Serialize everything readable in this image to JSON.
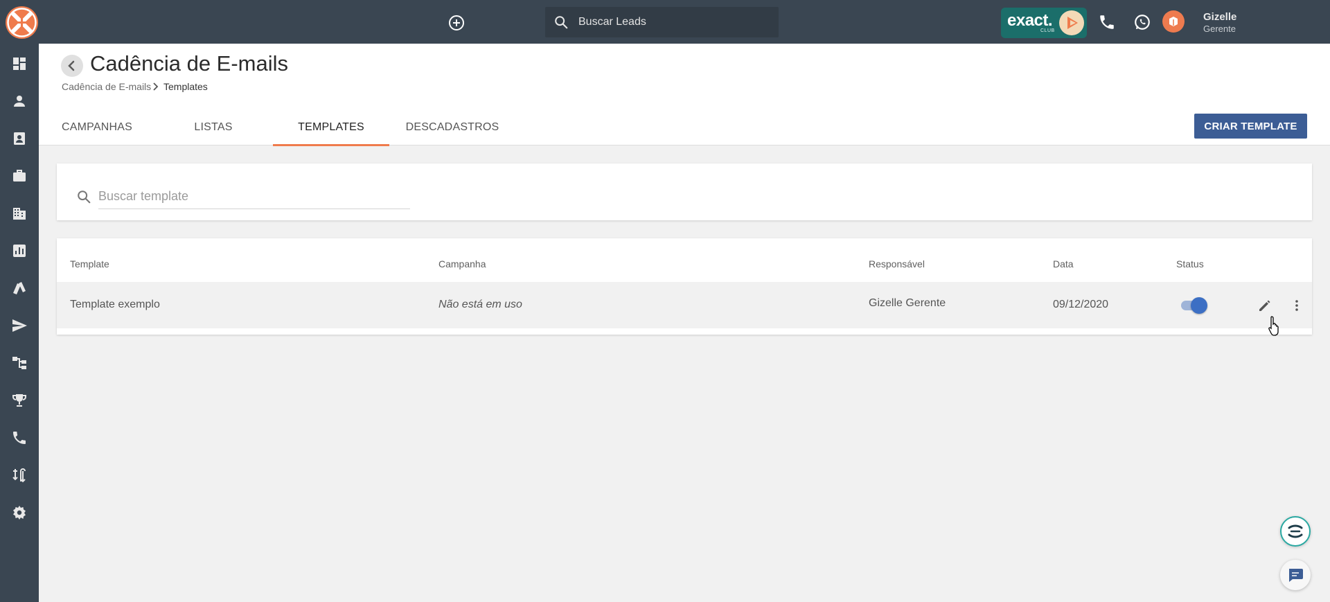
{
  "topbar": {
    "search_placeholder": "Buscar Leads",
    "badge": {
      "brand": "exact.",
      "sub": "CLUB"
    },
    "user": {
      "name": "Gizelle",
      "role": "Gerente"
    }
  },
  "sidebar": {
    "items": [
      "dashboard-icon",
      "person-icon",
      "contact-card-icon",
      "briefcase-icon",
      "building-icon",
      "report-chart-icon",
      "cards-icon",
      "send-icon",
      "hierarchy-icon",
      "trophy-icon",
      "phone-icon",
      "transfer-icon",
      "settings-icon"
    ]
  },
  "header": {
    "title": "Cadência de E-mails",
    "breadcrumb": {
      "parent": "Cadência de E-mails",
      "current": "Templates"
    },
    "tabs": [
      {
        "label": "CAMPANHAS",
        "active": false
      },
      {
        "label": "LISTAS",
        "active": false
      },
      {
        "label": "TEMPLATES",
        "active": true
      },
      {
        "label": "DESCADASTROS",
        "active": false
      }
    ],
    "create_button": "CRIAR TEMPLATE"
  },
  "search": {
    "placeholder": "Buscar template"
  },
  "table": {
    "columns": [
      "Template",
      "Campanha",
      "Responsável",
      "Data",
      "Status"
    ],
    "rows": [
      {
        "template": "Template exemplo",
        "campanha": "Não está em uso",
        "responsavel": "Gizelle Gerente",
        "data": "09/12/2020",
        "status": true
      }
    ]
  },
  "colors": {
    "topbar": "#3a4652",
    "accent_orange": "#ef7b4c",
    "primary_button": "#3c5d95",
    "toggle_on": "#3c6fc4",
    "badge_teal": "#1b6e6a"
  }
}
